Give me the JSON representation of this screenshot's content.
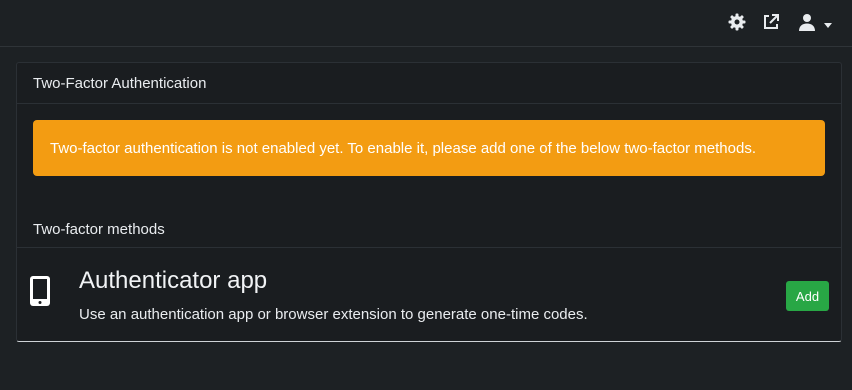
{
  "topbar": {
    "icons": [
      "gear-icon",
      "external-link-icon",
      "user-icon",
      "caret-down-icon"
    ]
  },
  "card": {
    "title": "Two-Factor Authentication",
    "alert_text": "Two-factor authentication is not enabled yet. To enable it, please add one of the below two-factor methods.",
    "section_title": "Two-factor methods",
    "methods": [
      {
        "icon": "mobile-phone-icon",
        "title": "Authenticator app",
        "description": "Use an authentication app or browser extension to generate one-time codes.",
        "button_label": "Add"
      }
    ]
  },
  "colors": {
    "background": "#1d2124",
    "alert": "#f39c12",
    "success": "#28a745"
  }
}
